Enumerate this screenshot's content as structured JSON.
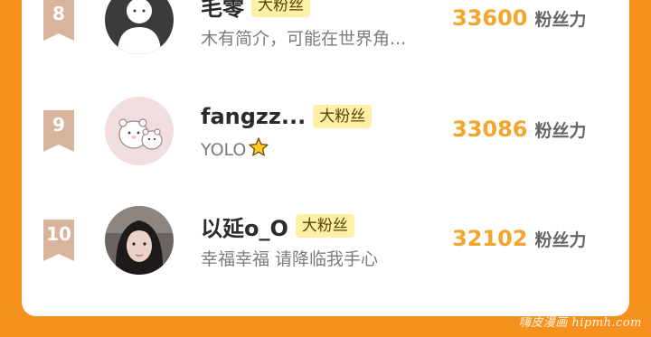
{
  "leaderboard": {
    "rows": [
      {
        "rank": "8",
        "name": "毛零",
        "badge": "大粉丝",
        "bio": "木有简介，可能在世界角...",
        "score": "33600",
        "unit": "粉丝力",
        "avatar_icon": "default-person-avatar"
      },
      {
        "rank": "9",
        "name": "fangzz...",
        "badge": "大粉丝",
        "bio": "YOLO",
        "bio_emoji": "star-icon",
        "score": "33086",
        "unit": "粉丝力",
        "avatar_icon": "bear-cartoon-avatar"
      },
      {
        "rank": "10",
        "name": "以延o_O",
        "badge": "大粉丝",
        "bio": "幸福幸福 请降临我手心",
        "score": "32102",
        "unit": "粉丝力",
        "avatar_icon": "portrait-photo-avatar"
      }
    ]
  },
  "watermark": "嗨皮漫画 hipmh.com",
  "colors": {
    "background": "#f7911e",
    "card": "#ffffff",
    "rank_ribbon": "#d9b49c",
    "badge_bg": "#fff0a8",
    "score": "#f3a52c"
  }
}
